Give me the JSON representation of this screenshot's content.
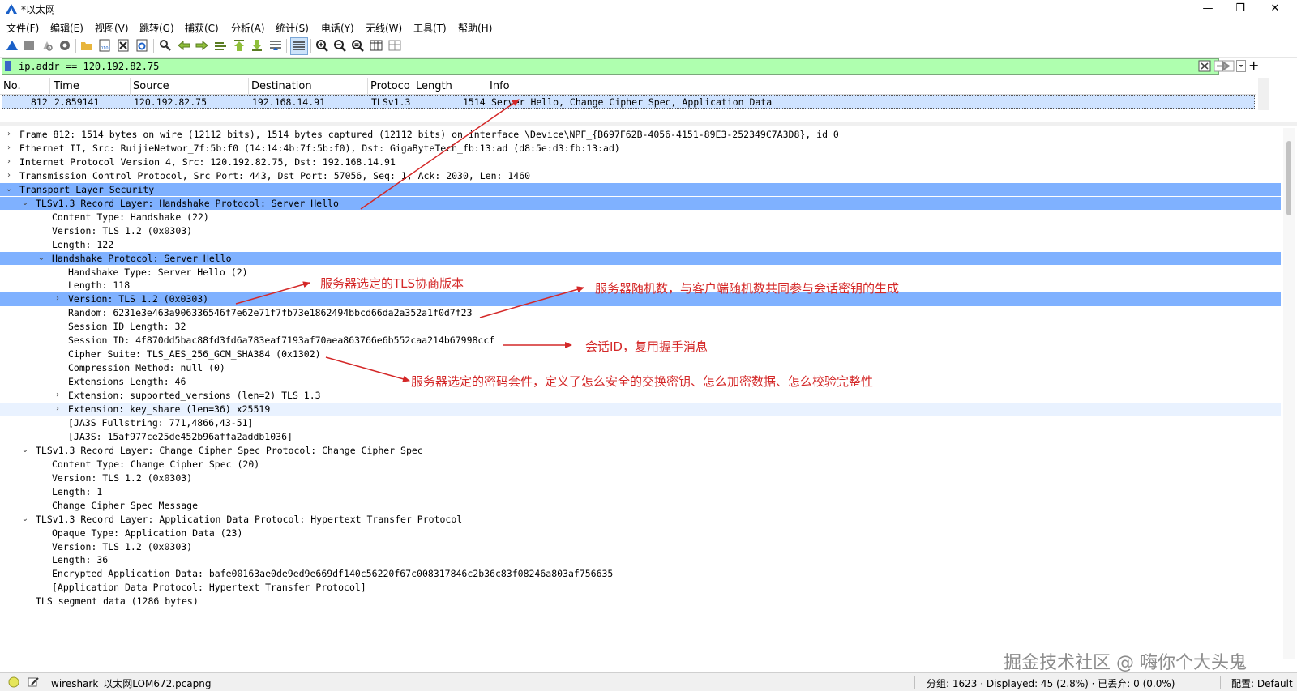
{
  "window": {
    "title": "*以太网",
    "minimize": "—",
    "restore": "❐",
    "close": "✕"
  },
  "menu": [
    "文件(F)",
    "编辑(E)",
    "视图(V)",
    "跳转(G)",
    "捕获(C)",
    "分析(A)",
    "统计(S)",
    "电话(Y)",
    "无线(W)",
    "工具(T)",
    "帮助(H)"
  ],
  "toolbar": {
    "icons": [
      "shark-fin-start-icon",
      "stop-icon",
      "restart-icon",
      "options-gear-icon",
      "open-folder-icon",
      "save-file-icon",
      "close-file-icon",
      "reload-icon",
      "find-packet-icon",
      "go-back-icon",
      "go-forward-icon",
      "go-to-packet-icon",
      "go-first-icon",
      "go-last-icon",
      "autoscroll-icon",
      "colorize-icon",
      "zoom-in-icon",
      "zoom-out-icon",
      "zoom-normal-icon",
      "resize-columns-icon",
      "layout-icon"
    ]
  },
  "filter": {
    "value": "ip.addr ==  120.192.82.75",
    "bg_color": "#afffaf",
    "add_label": "+"
  },
  "packet_list": {
    "columns": [
      "No.",
      "Time",
      "Source",
      "Destination",
      "Protoco",
      "Length",
      "Info"
    ],
    "rows": [
      {
        "no": "812",
        "time": "2.859141",
        "source": "120.192.82.75",
        "destination": "192.168.14.91",
        "protocol": "TLSv1.3",
        "length": "1514",
        "info": "Server Hello, Change Cipher Spec, Application Data"
      }
    ]
  },
  "details": [
    {
      "indent": 0,
      "arrow": "right",
      "text": "Frame 812: 1514 bytes on wire (12112 bits), 1514 bytes captured (12112 bits) on interface \\Device\\NPF_{B697F62B-4056-4151-89E3-252349C7A3D8}, id 0"
    },
    {
      "indent": 0,
      "arrow": "right",
      "text": "Ethernet II, Src: RuijieNetwor_7f:5b:f0 (14:14:4b:7f:5b:f0), Dst: GigaByteTech_fb:13:ad (d8:5e:d3:fb:13:ad)"
    },
    {
      "indent": 0,
      "arrow": "right",
      "text": "Internet Protocol Version 4, Src: 120.192.82.75, Dst: 192.168.14.91"
    },
    {
      "indent": 0,
      "arrow": "right",
      "text": "Transmission Control Protocol, Src Port: 443, Dst Port: 57056, Seq: 1, Ack: 2030, Len: 1460"
    },
    {
      "indent": 0,
      "arrow": "down",
      "text": "Transport Layer Security",
      "state": "sel"
    },
    {
      "indent": 1,
      "arrow": "down",
      "text": "TLSv1.3 Record Layer: Handshake Protocol: Server Hello",
      "state": "sel"
    },
    {
      "indent": 2,
      "arrow": "",
      "text": "Content Type: Handshake (22)"
    },
    {
      "indent": 2,
      "arrow": "",
      "text": "Version: TLS 1.2 (0x0303)"
    },
    {
      "indent": 2,
      "arrow": "",
      "text": "Length: 122"
    },
    {
      "indent": 2,
      "arrow": "down",
      "text": "Handshake Protocol: Server Hello",
      "state": "sel"
    },
    {
      "indent": 3,
      "arrow": "",
      "text": "Handshake Type: Server Hello (2)"
    },
    {
      "indent": 3,
      "arrow": "",
      "text": "Length: 118"
    },
    {
      "indent": 3,
      "arrow": "right",
      "text": "Version: TLS 1.2 (0x0303)",
      "state": "sel"
    },
    {
      "indent": 3,
      "arrow": "",
      "text": "Random: 6231e3e463a906336546f7e62e71f7fb73e1862494bbcd66da2a352a1f0d7f23"
    },
    {
      "indent": 3,
      "arrow": "",
      "text": "Session ID Length: 32"
    },
    {
      "indent": 3,
      "arrow": "",
      "text": "Session ID: 4f870dd5bac88fd3fd6a783eaf7193af70aea863766e6b552caa214b67998ccf"
    },
    {
      "indent": 3,
      "arrow": "",
      "text": "Cipher Suite: TLS_AES_256_GCM_SHA384 (0x1302)"
    },
    {
      "indent": 3,
      "arrow": "",
      "text": "Compression Method: null (0)"
    },
    {
      "indent": 3,
      "arrow": "",
      "text": "Extensions Length: 46"
    },
    {
      "indent": 3,
      "arrow": "right",
      "text": "Extension: supported_versions (len=2) TLS 1.3"
    },
    {
      "indent": 3,
      "arrow": "right",
      "text": "Extension: key_share (len=36) x25519",
      "state": "hl"
    },
    {
      "indent": 3,
      "arrow": "",
      "text": "[JA3S Fullstring: 771,4866,43-51]"
    },
    {
      "indent": 3,
      "arrow": "",
      "text": "[JA3S: 15af977ce25de452b96affa2addb1036]"
    },
    {
      "indent": 1,
      "arrow": "down",
      "text": "TLSv1.3 Record Layer: Change Cipher Spec Protocol: Change Cipher Spec"
    },
    {
      "indent": 2,
      "arrow": "",
      "text": "Content Type: Change Cipher Spec (20)"
    },
    {
      "indent": 2,
      "arrow": "",
      "text": "Version: TLS 1.2 (0x0303)"
    },
    {
      "indent": 2,
      "arrow": "",
      "text": "Length: 1"
    },
    {
      "indent": 2,
      "arrow": "",
      "text": "Change Cipher Spec Message"
    },
    {
      "indent": 1,
      "arrow": "down",
      "text": "TLSv1.3 Record Layer: Application Data Protocol: Hypertext Transfer Protocol"
    },
    {
      "indent": 2,
      "arrow": "",
      "text": "Opaque Type: Application Data (23)"
    },
    {
      "indent": 2,
      "arrow": "",
      "text": "Version: TLS 1.2 (0x0303)"
    },
    {
      "indent": 2,
      "arrow": "",
      "text": "Length: 36"
    },
    {
      "indent": 2,
      "arrow": "",
      "text": "Encrypted Application Data: bafe00163ae0de9ed9e669df140c56220f67c008317846c2b36c83f08246a803af756635"
    },
    {
      "indent": 2,
      "arrow": "",
      "text": "[Application Data Protocol: Hypertext Transfer Protocol]"
    },
    {
      "indent": 1,
      "arrow": "",
      "text": "TLS segment data (1286 bytes)"
    }
  ],
  "annotations": {
    "tls_version": "服务器选定的TLS协商版本",
    "random": "服务器随机数，与客户端随机数共同参与会话密钥的生成",
    "session_id": "会话ID，复用握手消息",
    "cipher_suite": "服务器选定的密码套件，定义了怎么安全的交换密钥、怎么加密数据、怎么校验完整性",
    "color": "#d42828"
  },
  "watermark": "掘金技术社区 @ 嗨你个大头鬼",
  "statusbar": {
    "file": "wireshark_以太网LOM672.pcapng",
    "stats": "分组: 1623 · Displayed: 45 (2.8%) · 已丢弃: 0 (0.0%)",
    "profile": "配置: Default"
  }
}
